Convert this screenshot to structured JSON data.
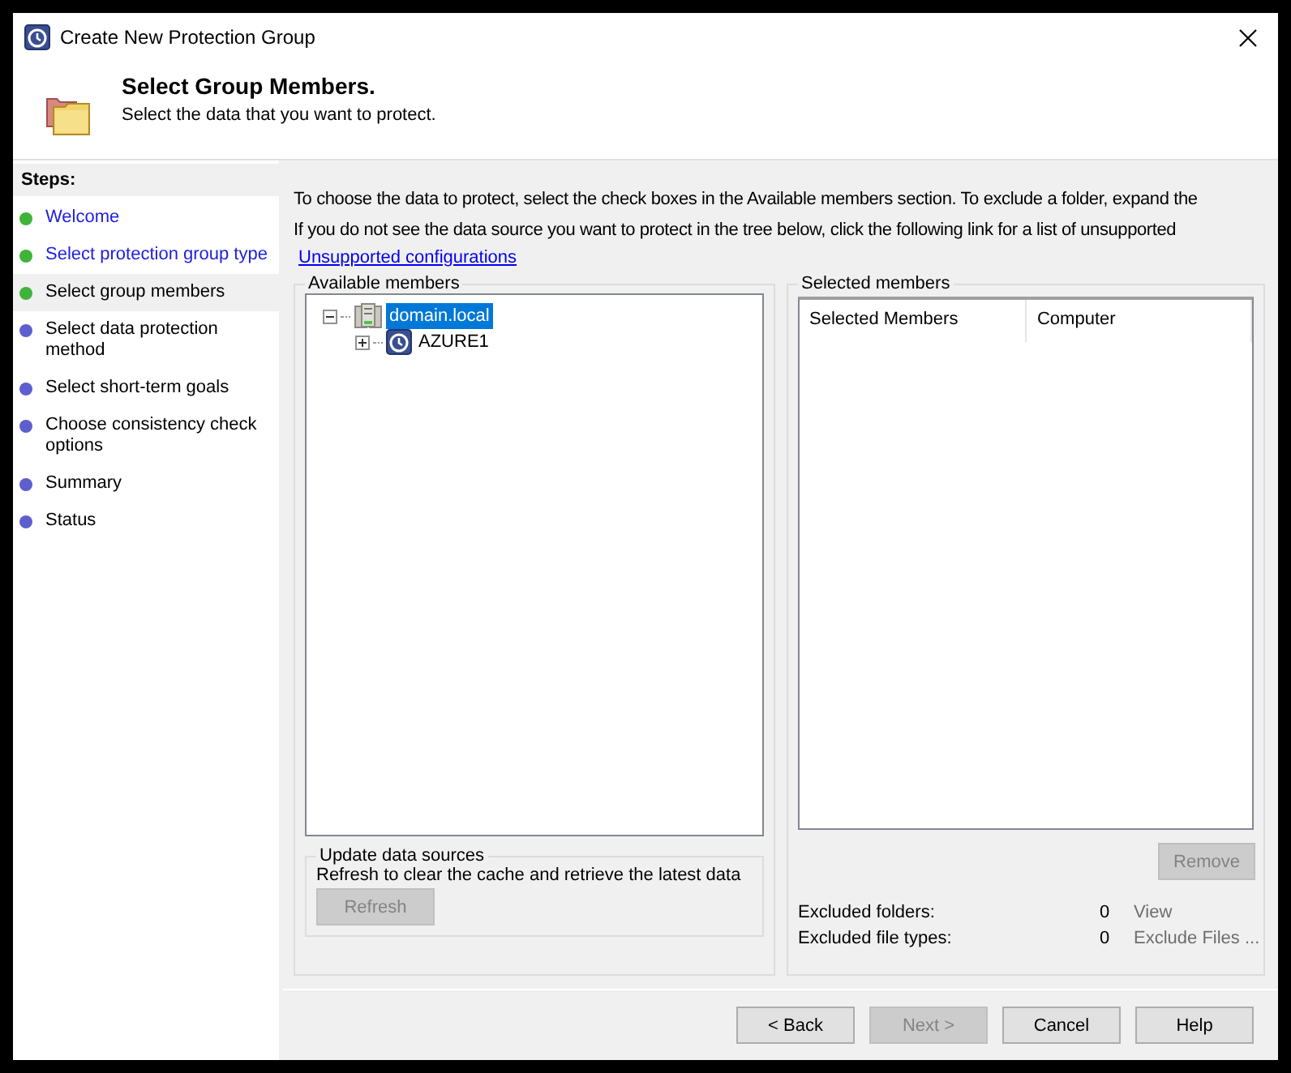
{
  "window": {
    "title": "Create New Protection Group"
  },
  "header": {
    "title": "Select Group Members.",
    "subtitle": "Select the data that you want to protect."
  },
  "steps": {
    "title": "Steps:",
    "items": [
      {
        "label": "Welcome",
        "kind": "done",
        "selected": false
      },
      {
        "label": "Select protection group type",
        "kind": "done",
        "selected": false
      },
      {
        "label": "Select group members",
        "kind": "done",
        "selected": true
      },
      {
        "label": "Select data protection method",
        "kind": "pending",
        "selected": false
      },
      {
        "label": "Select short-term goals",
        "kind": "pending",
        "selected": false
      },
      {
        "label": "Choose consistency check options",
        "kind": "pending",
        "selected": false
      },
      {
        "label": "Summary",
        "kind": "pending",
        "selected": false
      },
      {
        "label": "Status",
        "kind": "pending",
        "selected": false
      }
    ]
  },
  "instructions": [
    "To choose the data to protect, select the check boxes in the Available members section. To exclude a folder, expand the",
    "If you do not see the data source you want to protect in the tree below, click the following link for a list of unsupported"
  ],
  "link": "Unsupported configurations",
  "available_members": {
    "title": "Available members",
    "tree": [
      {
        "label": "domain.local",
        "kind": "domain",
        "expanded": true,
        "selected": true,
        "children": [
          {
            "label": "AZURE1",
            "kind": "server",
            "expanded": false,
            "selected": false
          }
        ]
      }
    ]
  },
  "update_data_sources": {
    "title": "Update data sources",
    "text": "Refresh to clear the cache and retrieve the latest data",
    "button": {
      "label": "Refresh",
      "disabled": true
    }
  },
  "selected_members": {
    "title": "Selected members",
    "columns": [
      "Selected Members",
      "Computer"
    ],
    "button": {
      "label": "Remove",
      "disabled": true
    },
    "exclusions": [
      {
        "label": "Excluded folders:",
        "count": "0",
        "action": "View",
        "disabled": true
      },
      {
        "label": "Excluded file types:",
        "count": "0",
        "action": "Exclude Files ...",
        "disabled": true
      }
    ]
  },
  "buttons": [
    {
      "label": "< Back",
      "disabled": false
    },
    {
      "label": "Next >",
      "disabled": true
    },
    {
      "label": "Cancel",
      "disabled": false
    },
    {
      "label": "Help",
      "disabled": false
    }
  ]
}
